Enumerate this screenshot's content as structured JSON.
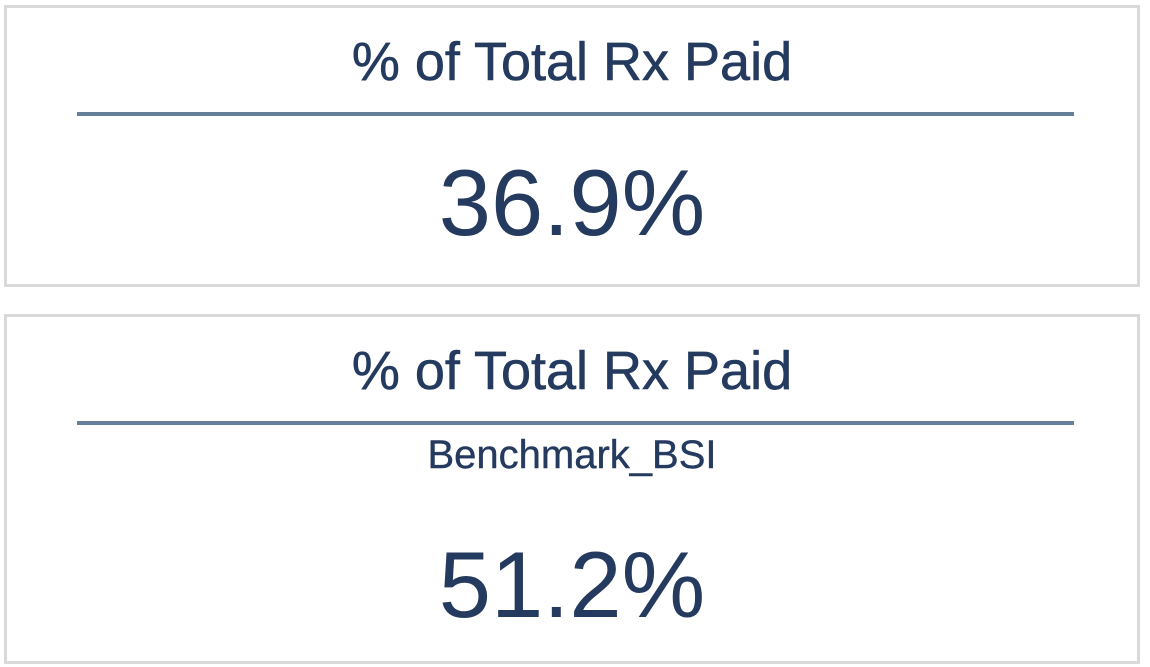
{
  "cards": [
    {
      "title": "% of Total Rx Paid",
      "subtitle": "",
      "value": "36.9%"
    },
    {
      "title": "% of Total Rx Paid",
      "subtitle": "Benchmark_BSI",
      "value": "51.2%"
    }
  ],
  "colors": {
    "text": "#243a5e",
    "divider": "#66809c",
    "card_border": "#d9d9d9",
    "background": "#ffffff"
  }
}
